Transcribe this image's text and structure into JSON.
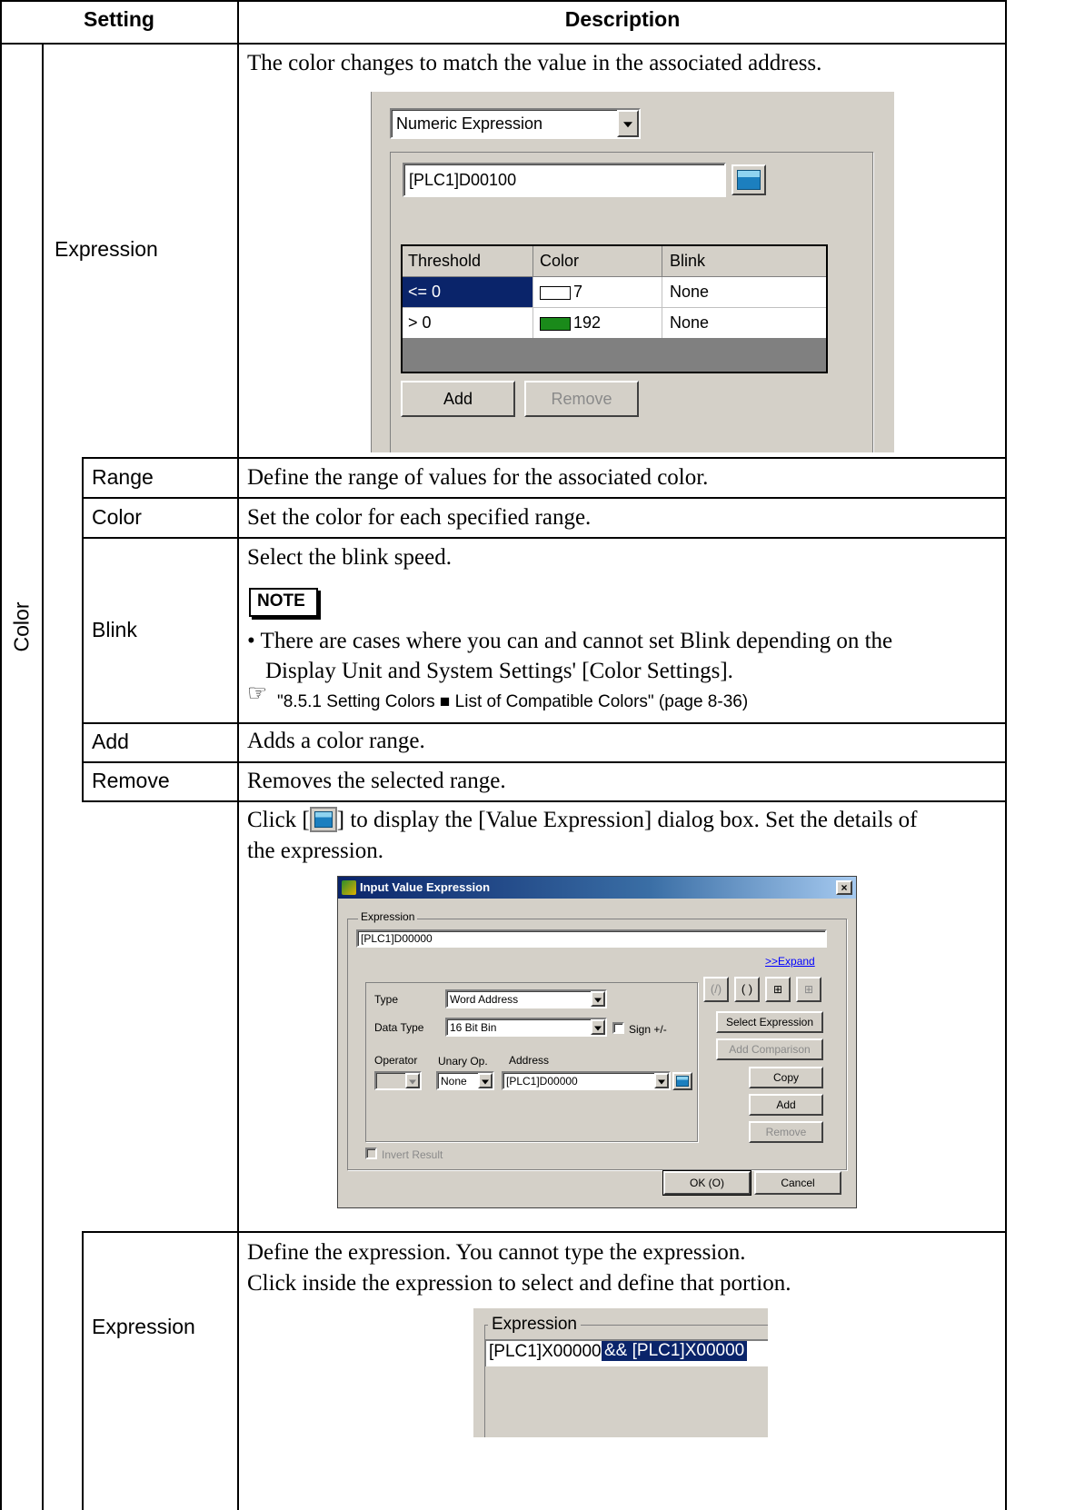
{
  "header": {
    "setting": "Setting",
    "description": "Description"
  },
  "labels": {
    "color": "Color",
    "expression": "Expression",
    "range": "Range",
    "color_sub": "Color",
    "blink": "Blink",
    "add": "Add",
    "remove": "Remove",
    "expression2": "Expression"
  },
  "desc": {
    "expression": "The color changes to match the value in the associated address.",
    "range": "Define the range of values for the associated color.",
    "color": "Set the color for each specified range.",
    "blink_line": "Select the blink speed.",
    "note_title": "NOTE",
    "note_bullet1": "• There are cases where you can and cannot set Blink depending on the",
    "note_bullet2": "Display Unit and System Settings' [Color Settings].",
    "note_ref": "\"8.5.1 Setting Colors ■ List of Compatible Colors\" (page 8-36)",
    "add": "Adds a color range.",
    "remove": "Removes the selected range.",
    "click_pre": "Click [",
    "click_post": "] to display the [Value Expression] dialog box. Set the details of",
    "click_line2": "the expression.",
    "expr2_line1": "Define the expression. You cannot type the expression.",
    "expr2_line2": "Click inside the expression to select and define that portion."
  },
  "shot1": {
    "dropdown_value": "Numeric Expression",
    "address_value": "[PLC1]D00100",
    "columns": [
      "Threshold",
      "Color",
      "Blink"
    ],
    "rows": [
      {
        "threshold": "<= 0",
        "color_value": "7",
        "swatch": "#ffffff",
        "blink": "None"
      },
      {
        "threshold": "> 0",
        "color_value": "192",
        "swatch": "#1a8a1a",
        "blink": "None"
      }
    ],
    "add_label": "Add",
    "remove_label": "Remove"
  },
  "dialog": {
    "title": "Input Value Expression",
    "expression_group": "Expression",
    "expression_value": "[PLC1]D00000",
    "expand_link": ">>Expand",
    "type_label": "Type",
    "type_value": "Word Address",
    "data_type_label": "Data Type",
    "data_type_value": "16 Bit Bin",
    "sign_label": "Sign +/-",
    "operator_label": "Operator",
    "unary_label": "Unary Op.",
    "address_label": "Address",
    "unary_value": "None",
    "address_value": "[PLC1]D00000",
    "select_expression": "Select Expression",
    "add_comparison": "Add Comparison",
    "copy": "Copy",
    "add": "Add",
    "remove": "Remove",
    "invert_result": "Invert Result",
    "ok": "OK (O)",
    "cancel": "Cancel"
  },
  "shot3": {
    "group_label": "Expression",
    "part1": "[PLC1]X00000",
    "part2_selected": " && [PLC1]X00000"
  }
}
